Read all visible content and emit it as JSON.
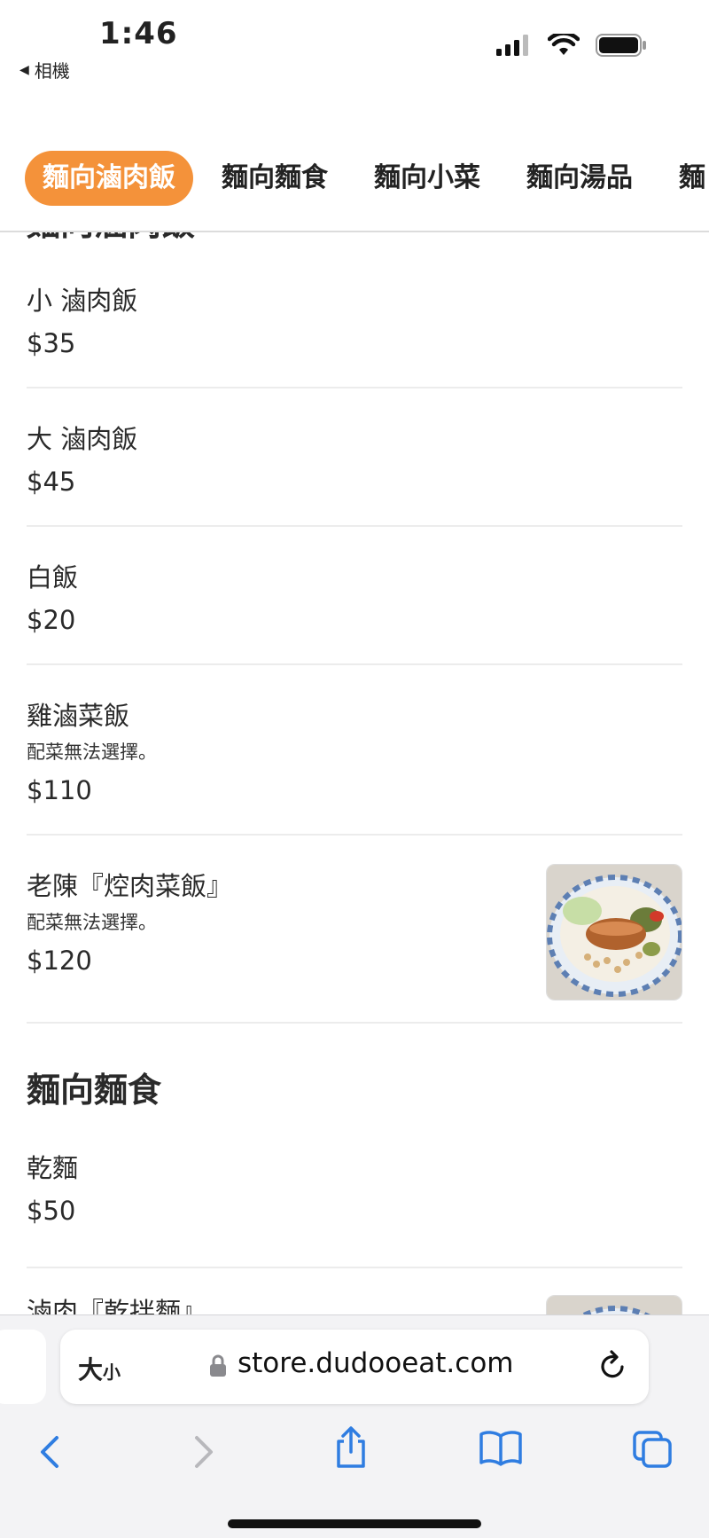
{
  "status_bar": {
    "time": "1:46",
    "back_label": "相機",
    "back_icon": "back-triangle-icon"
  },
  "tabs": [
    {
      "label": "麵向滷肉飯",
      "active": true
    },
    {
      "label": "麵向麵食",
      "active": false
    },
    {
      "label": "麵向小菜",
      "active": false
    },
    {
      "label": "麵向湯品",
      "active": false
    },
    {
      "label": "麵",
      "active": false
    }
  ],
  "menu": {
    "section1": {
      "title": "麵向滷肉飯",
      "items": [
        {
          "name": "小 滷肉飯",
          "price": "$35"
        },
        {
          "name": "大 滷肉飯",
          "price": "$45"
        },
        {
          "name": "白飯",
          "price": "$20"
        },
        {
          "name": "雞滷菜飯",
          "note": "配菜無法選擇。",
          "price": "$110"
        },
        {
          "name": "老陳『焢肉菜飯』",
          "note": "配菜無法選擇。",
          "price": "$120",
          "image": "braised-pork-rice-bowl-photo"
        }
      ]
    },
    "section2": {
      "title": "麵向麵食",
      "items": [
        {
          "name": "乾麵",
          "price": "$50"
        },
        {
          "name": "滷肉『乾拌麵』",
          "image": "noodle-bowl-photo"
        }
      ]
    }
  },
  "browser": {
    "text_size_label": "大小",
    "text_size_big": "大",
    "text_size_small": "小",
    "url": "store.dudooeat.com"
  },
  "colors": {
    "accent": "#f4923a",
    "toolbar_blue": "#2f7de1"
  }
}
